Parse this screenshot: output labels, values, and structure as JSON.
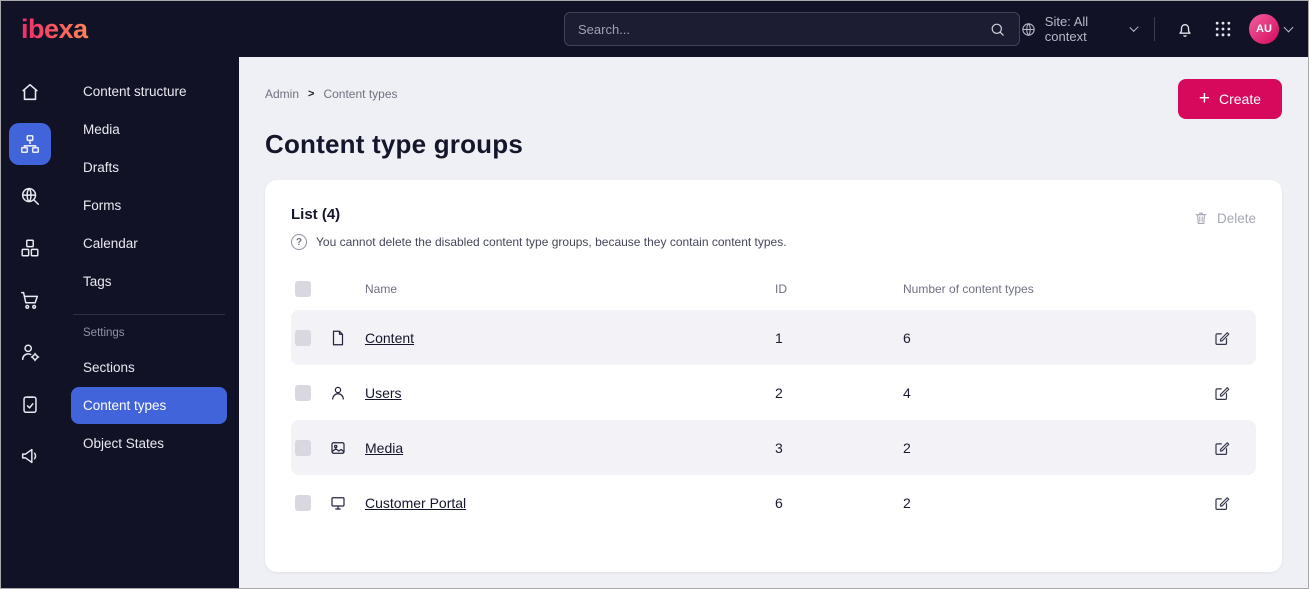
{
  "topbar": {
    "logo_text": "ibexa",
    "search_placeholder": "Search...",
    "site_context_label": "Site: All context",
    "avatar_initials": "AU"
  },
  "icons": {
    "plus_glyph": "+",
    "question_glyph": "?"
  },
  "sidebar": {
    "items": [
      {
        "label": "Content structure",
        "active": false
      },
      {
        "label": "Media",
        "active": false
      },
      {
        "label": "Drafts",
        "active": false
      },
      {
        "label": "Forms",
        "active": false
      },
      {
        "label": "Calendar",
        "active": false
      },
      {
        "label": "Tags",
        "active": false
      }
    ],
    "settings_section_label": "Settings",
    "settings_items": [
      {
        "label": "Sections",
        "active": false
      },
      {
        "label": "Content types",
        "active": true
      },
      {
        "label": "Object States",
        "active": false
      }
    ]
  },
  "main": {
    "breadcrumb": {
      "root": "Admin",
      "separator": ">",
      "current": "Content types"
    },
    "create_button_label": "Create",
    "page_title": "Content type groups",
    "card": {
      "list_title": "List (4)",
      "hint_text": "You cannot delete the disabled content type groups, because they contain content types.",
      "delete_button_label": "Delete",
      "table": {
        "headers": {
          "name": "Name",
          "id": "ID",
          "count": "Number of content types"
        },
        "rows": [
          {
            "icon": "file-icon",
            "name": "Content",
            "id": "1",
            "count": "6"
          },
          {
            "icon": "user-icon",
            "name": "Users",
            "id": "2",
            "count": "4"
          },
          {
            "icon": "image-icon",
            "name": "Media",
            "id": "3",
            "count": "2"
          },
          {
            "icon": "monitor-icon",
            "name": "Customer Portal",
            "id": "6",
            "count": "2"
          }
        ]
      }
    }
  },
  "colors": {
    "topbar_bg": "#111226",
    "accent_pink": "#d6095c",
    "accent_blue": "#4264db",
    "stripe": "#f3f3f7"
  }
}
